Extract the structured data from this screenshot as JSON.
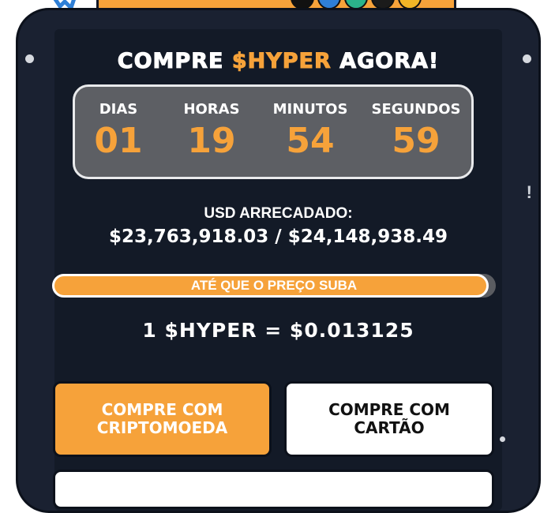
{
  "hero": {
    "title_prefix": "COMPRE ",
    "title_accent": "$HYPER",
    "title_suffix": " AGORA!"
  },
  "countdown": {
    "units": [
      {
        "label": "DIAS",
        "value": "01"
      },
      {
        "label": "HORAS",
        "value": "19"
      },
      {
        "label": "MINUTOS",
        "value": "54"
      },
      {
        "label": "SEGUNDOS",
        "value": "59"
      }
    ]
  },
  "raised": {
    "label": "USD ARRECADADO:",
    "value": "$23,763,918.03 / $24,148,938.49",
    "progress_fraction": 0.984
  },
  "progress": {
    "text": "ATÉ QUE O PREÇO SUBA"
  },
  "price": {
    "text": "1 $HYPER = $0.013125"
  },
  "buttons": {
    "crypto_label": "COMPRE COM CRIPTOMOEDA",
    "card_label": "COMPRE COM CARTÃO"
  },
  "colors": {
    "accent": "#f6a23a",
    "panel_bg": "#1a2131",
    "countdown_bg": "#5d5f64"
  },
  "icons": {
    "coins": [
      "coin-black-icon",
      "coin-blue-icon",
      "coin-green-icon",
      "coin-black-icon",
      "coin-gold-icon"
    ]
  }
}
